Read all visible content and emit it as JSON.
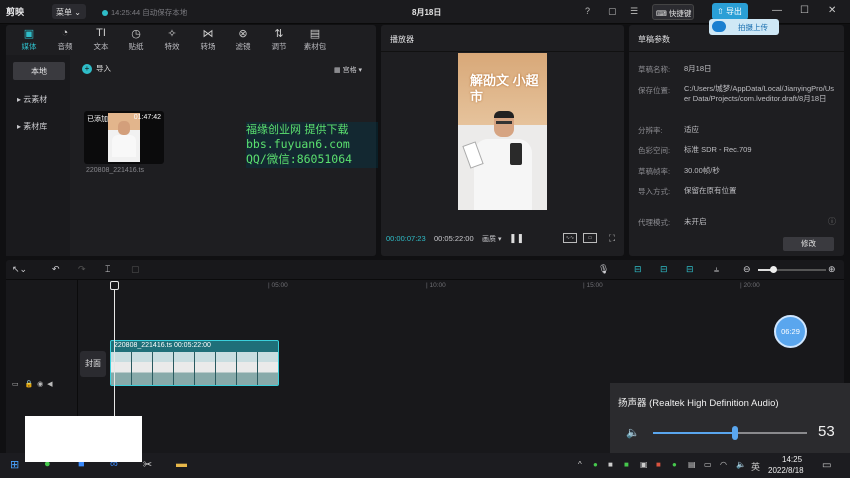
{
  "app": {
    "logo": "剪映",
    "menu": "菜单",
    "autosave": "14:25:44 自动保存本地",
    "doc_title": "8月18日",
    "shortcut": "快捷键",
    "export": "导出",
    "upload_tip": "拍摄上传"
  },
  "media_tabs": [
    {
      "label": "媒体",
      "icon": "media-icon"
    },
    {
      "label": "音频",
      "icon": "audio-icon"
    },
    {
      "label": "文本",
      "icon": "text-icon"
    },
    {
      "label": "贴纸",
      "icon": "sticker-icon"
    },
    {
      "label": "特效",
      "icon": "effects-icon"
    },
    {
      "label": "转场",
      "icon": "transition-icon"
    },
    {
      "label": "滤镜",
      "icon": "filter-icon"
    },
    {
      "label": "调节",
      "icon": "adjust-icon"
    },
    {
      "label": "素材包",
      "icon": "package-icon"
    }
  ],
  "media_side": [
    "本地",
    "▸ 云素材",
    "▸ 素材库"
  ],
  "media": {
    "import": "导入",
    "view_mode": "宫格",
    "clip_added": "已添加",
    "clip_duration": "01:47:42",
    "clip_name": "220808_221416.ts"
  },
  "watermark": [
    "福缘创业网 提供下载",
    "bbs.fuyuan6.com",
    "QQ/微信:86051064"
  ],
  "player": {
    "title": "播放器",
    "video_text": "解劭文 小超市",
    "time_current": "00:00:07:23",
    "time_total": "00:05:22:00",
    "ratio": "画质 ▾"
  },
  "params": {
    "title": "草稿参数",
    "rows": [
      {
        "label": "草稿名称:",
        "value": "8月18日"
      },
      {
        "label": "保存位置:",
        "value": "C:/Users/城梦/AppData/Local/JianyingPro/User Data/Projects/com.lveditor.draft/8月18日"
      },
      {
        "label": "分辨率:",
        "value": "适应"
      },
      {
        "label": "色彩空间:",
        "value": "标准 SDR - Rec.709"
      },
      {
        "label": "草稿帧率:",
        "value": "30.00帧/秒"
      },
      {
        "label": "导入方式:",
        "value": "保留在原有位置"
      },
      {
        "label": "代理模式:",
        "value": "未开启"
      }
    ],
    "modify": "修改"
  },
  "timeline": {
    "ruler": [
      "| 05:00",
      "| 10:00",
      "| 15:00",
      "| 20:00"
    ],
    "cover": "封面",
    "clip_label": "220808_221416.ts  00:05:22:00",
    "bubble": "06:29"
  },
  "volume": {
    "device": "扬声器 (Realtek High Definition Audio)",
    "level": 53,
    "level_text": "53"
  },
  "taskbar": {
    "time": "14:25",
    "date": "2022/8/18",
    "ime": "英"
  }
}
